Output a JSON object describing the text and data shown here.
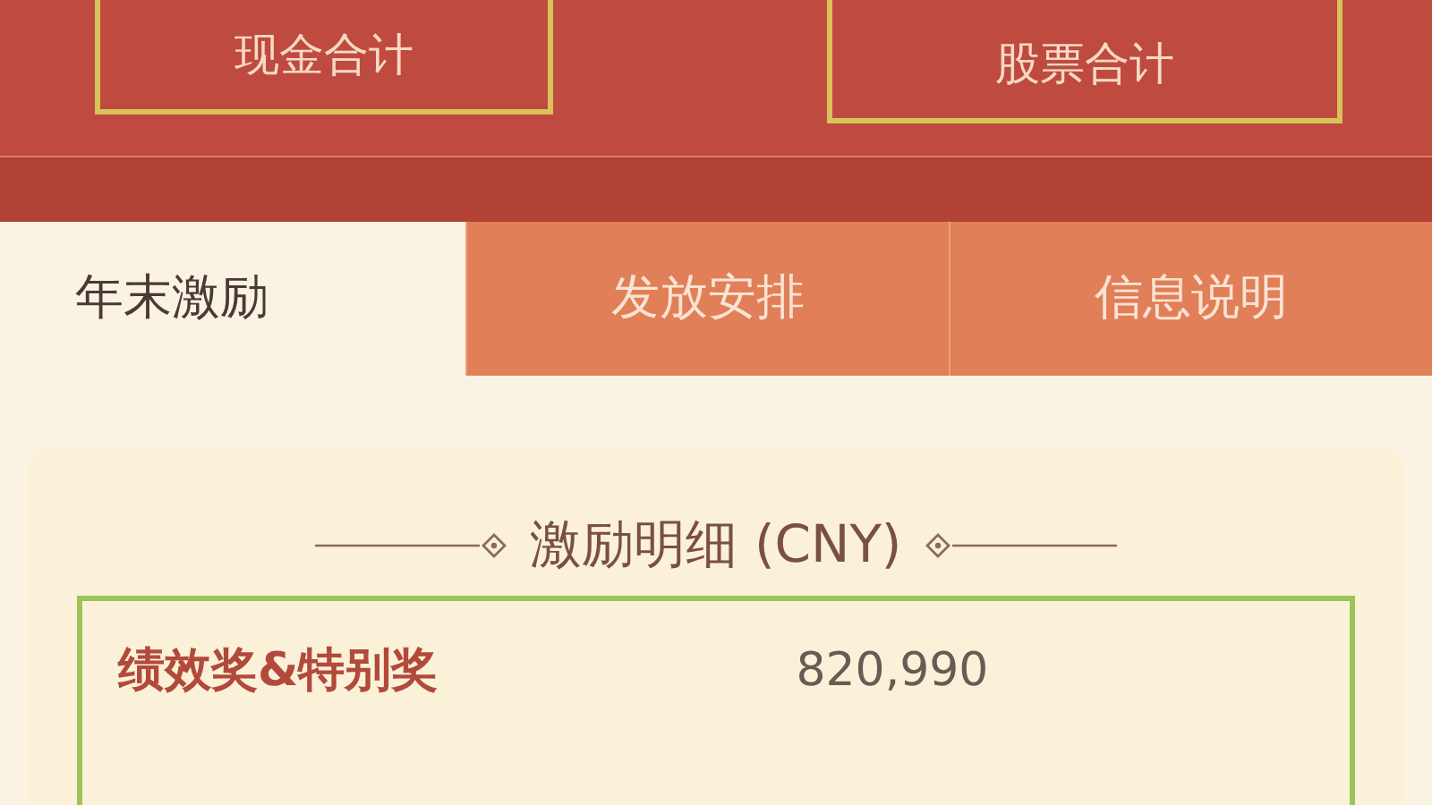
{
  "summary_cards": [
    {
      "label": "现金合计"
    },
    {
      "label": "股票合计"
    }
  ],
  "tabs": [
    {
      "label": "年末激励",
      "selected": true
    },
    {
      "label": "发放安排",
      "selected": false
    },
    {
      "label": "信息说明",
      "selected": false
    }
  ],
  "detail": {
    "title": "激励明细 (CNY)",
    "rows": [
      {
        "label": "绩效奖&特别奖",
        "value": "820,990"
      }
    ]
  }
}
